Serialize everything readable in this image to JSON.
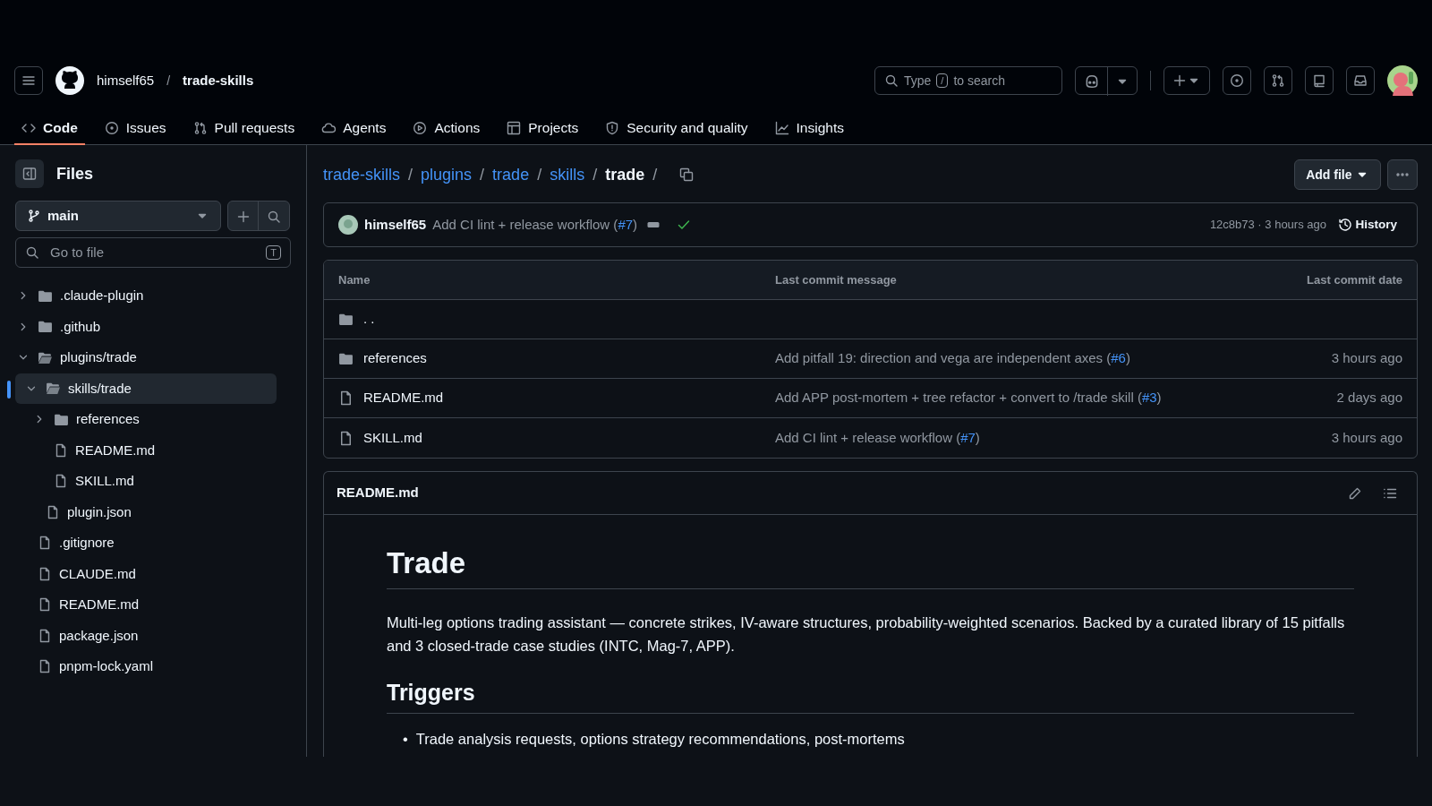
{
  "header": {
    "owner": "himself65",
    "separator": "/",
    "repo": "trade-skills",
    "search": {
      "before": "Type",
      "key": "/",
      "after": "to search"
    }
  },
  "tabs": [
    {
      "label": "Code",
      "selected": true
    },
    {
      "label": "Issues",
      "selected": false
    },
    {
      "label": "Pull requests",
      "selected": false
    },
    {
      "label": "Agents",
      "selected": false
    },
    {
      "label": "Actions",
      "selected": false
    },
    {
      "label": "Projects",
      "selected": false
    },
    {
      "label": "Security and quality",
      "selected": false
    },
    {
      "label": "Insights",
      "selected": false
    }
  ],
  "sidebar": {
    "title": "Files",
    "branch": "main",
    "goto": {
      "placeholder": "Go to file",
      "shortcut": "T"
    },
    "tree": [
      {
        "name": ".claude-plugin",
        "kind": "folder",
        "expanded": false,
        "selected": false
      },
      {
        "name": ".github",
        "kind": "folder",
        "expanded": false,
        "selected": false
      },
      {
        "name": "plugins/trade",
        "kind": "folder",
        "expanded": true,
        "selected": false,
        "children": [
          {
            "name": "skills/trade",
            "kind": "folder",
            "expanded": true,
            "selected": true,
            "children": [
              {
                "name": "references",
                "kind": "folder",
                "expanded": false,
                "selected": false
              },
              {
                "name": "README.md",
                "kind": "file",
                "selected": false
              },
              {
                "name": "SKILL.md",
                "kind": "file",
                "selected": false
              }
            ]
          },
          {
            "name": "plugin.json",
            "kind": "file",
            "selected": false
          }
        ]
      },
      {
        "name": ".gitignore",
        "kind": "file",
        "selected": false
      },
      {
        "name": "CLAUDE.md",
        "kind": "file",
        "selected": false
      },
      {
        "name": "README.md",
        "kind": "file",
        "selected": false
      },
      {
        "name": "package.json",
        "kind": "file",
        "selected": false
      },
      {
        "name": "pnpm-lock.yaml",
        "kind": "file",
        "selected": false
      }
    ]
  },
  "breadcrumb": {
    "items": [
      {
        "label": "trade-skills",
        "current": false
      },
      {
        "label": "plugins",
        "current": false
      },
      {
        "label": "trade",
        "current": false
      },
      {
        "label": "skills",
        "current": false
      },
      {
        "label": "trade",
        "current": true
      }
    ],
    "separator": "/"
  },
  "add_file": "Add file",
  "commit": {
    "author": "himself65",
    "message": [
      {
        "text": "Add CI lint + release workflow ("
      },
      {
        "text": "#7",
        "link": true
      },
      {
        "text": ")"
      }
    ],
    "passed": true,
    "meta": "12c8b73 · 3 hours ago",
    "history": "History"
  },
  "table": {
    "columns": [
      "Name",
      "Last commit message",
      "Last commit date"
    ],
    "rows": [
      {
        "kind": "parent",
        "name": ". ."
      },
      {
        "kind": "folder",
        "name": "references",
        "message": [
          {
            "text": "Add pitfall 19: direction and vega are independent axes ("
          },
          {
            "text": "#6",
            "link": true
          },
          {
            "text": ")"
          }
        ],
        "date": "3 hours ago"
      },
      {
        "kind": "file",
        "name": "README.md",
        "message": [
          {
            "text": "Add APP post-mortem + tree refactor + convert to /trade skill ("
          },
          {
            "text": "#3",
            "link": true
          },
          {
            "text": ")"
          }
        ],
        "date": "2 days ago"
      },
      {
        "kind": "file",
        "name": "SKILL.md",
        "message": [
          {
            "text": "Add CI lint + release workflow ("
          },
          {
            "text": "#7",
            "link": true
          },
          {
            "text": ")"
          }
        ],
        "date": "3 hours ago"
      }
    ]
  },
  "readme": {
    "filename": "README.md",
    "title": "Trade",
    "intro": "Multi-leg options trading assistant — concrete strikes, IV-aware structures, probability-weighted scenarios. Backed by a curated library of 15 pitfalls and 3 closed-trade case studies (INTC, Mag-7, APP).",
    "section": "Triggers",
    "bullets": [
      {
        "marker": "•",
        "text": "Trade analysis requests, options strategy recommendations, post-mortems"
      }
    ]
  }
}
